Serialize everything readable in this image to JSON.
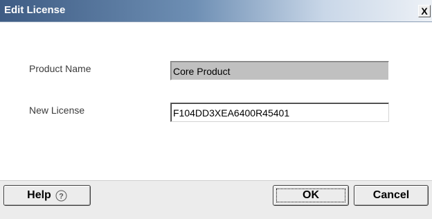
{
  "window": {
    "title": "Edit License",
    "close_glyph": "X"
  },
  "form": {
    "product_name_label": "Product Name",
    "product_name_value": "Core Product",
    "new_license_label": "New License",
    "new_license_value": "F104DD3XEA6400R45401"
  },
  "footer": {
    "help_label": "Help",
    "help_icon": "question-circle-icon",
    "ok_label": "OK",
    "cancel_label": "Cancel"
  },
  "colors": {
    "titlebar_start": "#3e5c84",
    "titlebar_end": "#edf1f6",
    "readonly_field_bg": "#c0c0c0",
    "footer_bg": "#ececec"
  }
}
